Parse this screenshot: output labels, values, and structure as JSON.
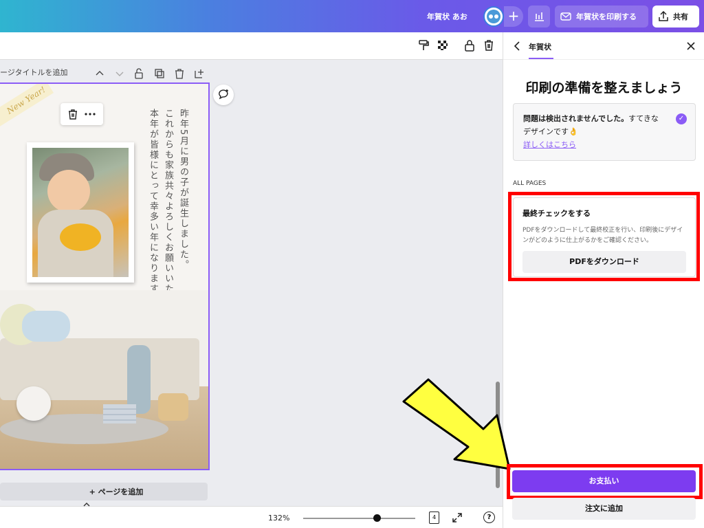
{
  "header": {
    "doc_title": "年賀状 あお",
    "print_label": "年賀状を印刷する",
    "share_label": "共有"
  },
  "canvas": {
    "page_title_placeholder": "ージタイトルを追加",
    "card_ribbon": "New Year!",
    "message_col1": "昨年5月に男の子が誕生しました。",
    "message_col2": "これからも家族共々よろしくお願いいたします。",
    "message_col3": "本年が皆様にとって幸多い年になりますように。",
    "add_page_label": "+ ページを追加"
  },
  "footer": {
    "zoom_level": "132%",
    "page_count": "4",
    "help": "?"
  },
  "panel": {
    "tab_label": "年賀状",
    "heading": "印刷の準備を整えましょう",
    "notice_bold": "問題は検出されませんでした。",
    "notice_text1": "すてきな",
    "notice_text2": "デザインです👌",
    "notice_link": "詳しくはこちら",
    "section_label": "ALL PAGES",
    "final_check_title": "最終チェックをする",
    "final_check_desc": "PDFをダウンロードして最終校正を行い、印刷後にデザインがどのように仕上がるかをご確認ください。",
    "download_button": "PDFをダウンロード",
    "pay_button": "お支払い",
    "order_button": "注文に追加"
  },
  "colors": {
    "accent": "#7d3cf0",
    "highlight": "#ff0000",
    "arrow_fill": "#ffff40"
  }
}
